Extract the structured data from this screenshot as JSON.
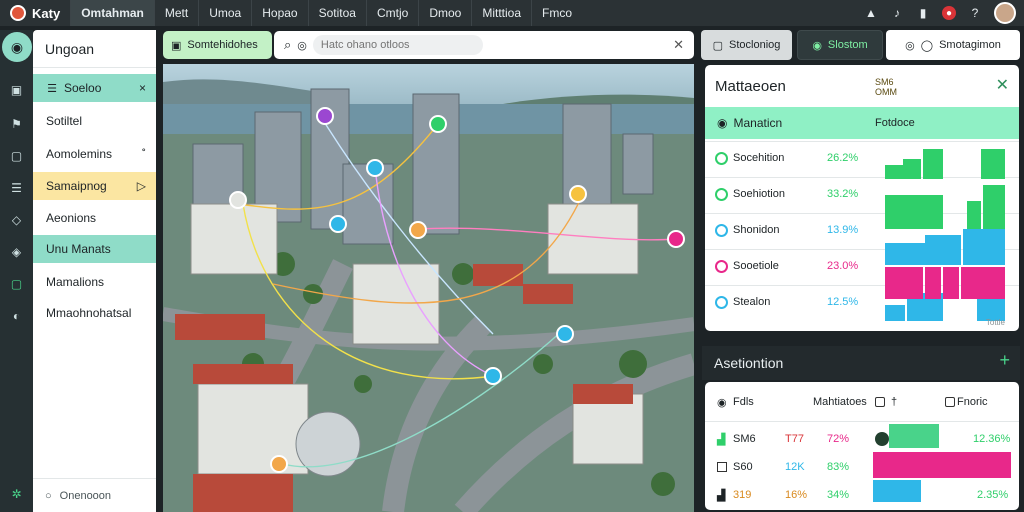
{
  "app": {
    "name": "Katy"
  },
  "menu": [
    "Omtahman",
    "Mett",
    "Umoa",
    "Hopao",
    "Sotitoa",
    "Cmtjo",
    "Dmoo",
    "Mitttioa",
    "Fmco"
  ],
  "colors": {
    "accent_teal": "#8fdcc8",
    "accent_green": "#2fcf6a",
    "accent_blue": "#2fb7e8",
    "accent_pink": "#e8288a",
    "highlight_yellow": "#fbe6a2"
  },
  "sidebar": {
    "title": "Ungoan",
    "items": [
      {
        "label": "Soeloo",
        "icon": "list-icon",
        "trailing": "×"
      },
      {
        "label": "Sotiltel",
        "icon": "",
        "trailing": ""
      },
      {
        "label": "Aomolemins",
        "icon": "",
        "trailing": "˚"
      },
      {
        "label": "Samaipnog",
        "icon": "",
        "trailing": "▷"
      },
      {
        "label": "Aeonions",
        "icon": "",
        "trailing": ""
      },
      {
        "label": "Unu Manats",
        "icon": "",
        "trailing": ""
      },
      {
        "label": "Mamalions",
        "icon": "",
        "trailing": ""
      },
      {
        "label": "Mmaohnohatsal",
        "icon": "",
        "trailing": ""
      }
    ],
    "footer_label": "Onenooon"
  },
  "toolbar": {
    "green_pill": "Somtehidohes",
    "search_placeholder": "Hatc ohano otloos"
  },
  "right_toolbar": {
    "button1": "Stocloniog",
    "button2": "Slostom",
    "button3": "Smotagimon"
  },
  "analysis": {
    "title": "Mattaeoen",
    "badge": "SM6 OMM",
    "sub_label": "Manaticn",
    "sub_right": "Fotdoce",
    "rows": [
      {
        "name": "Socehition",
        "pct": "26.2%",
        "color": "#2fcf6a"
      },
      {
        "name": "Soehiotion",
        "pct": "33.2%",
        "color": "#2fcf6a"
      },
      {
        "name": "Shonidon",
        "pct": "13.9%",
        "color": "#2fb7e8"
      },
      {
        "name": "Sooetiole",
        "pct": "23.0%",
        "color": "#e8288a"
      },
      {
        "name": "Stealon",
        "pct": "12.5%",
        "color": "#2fb7e8"
      }
    ],
    "footnote": "Tottle"
  },
  "lower": {
    "title": "Asetiontion",
    "columns": [
      "Fdls",
      "Mahtiatoes",
      "†",
      "Fnoric"
    ],
    "rows": [
      {
        "a": "SM6",
        "b": "T77",
        "c": "72%",
        "d": "12.36%",
        "fill": 0.36,
        "color": "#49d38a"
      },
      {
        "a": "S60",
        "b": "12K",
        "c": "83%",
        "d": "",
        "fill": 1.0,
        "color": "#e8288a"
      },
      {
        "a": "319",
        "b": "16%",
        "c": "34%",
        "d": "2.35%",
        "fill": 0.35,
        "color": "#2fb7e8"
      }
    ]
  }
}
